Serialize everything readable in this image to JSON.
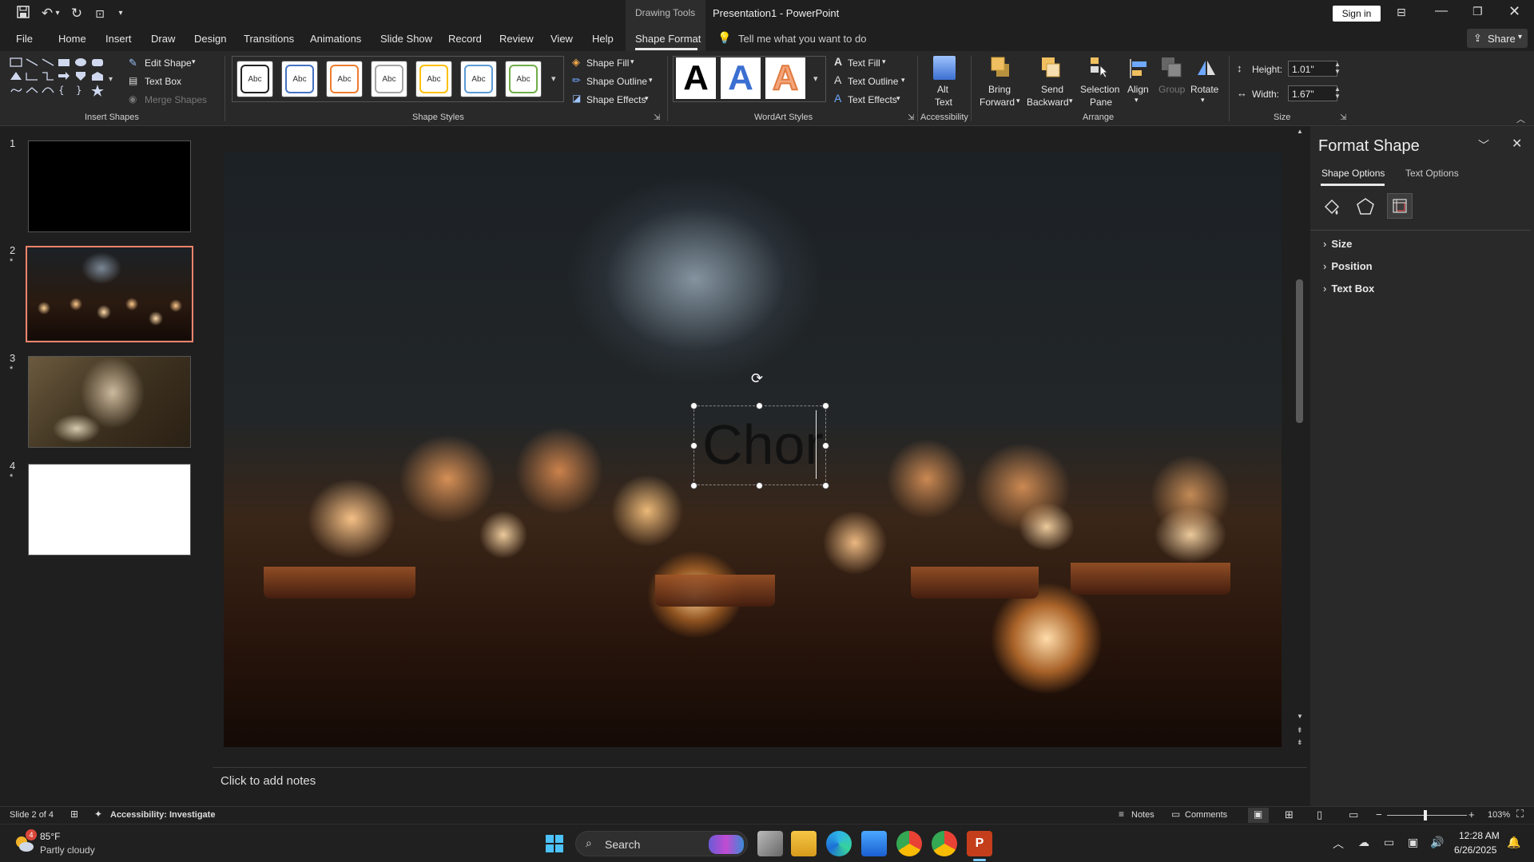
{
  "titlebar": {
    "context_tools": "Drawing Tools",
    "doc_title": "Presentation1 - PowerPoint",
    "sign_in": "Sign in"
  },
  "tabs": [
    "File",
    "Home",
    "Insert",
    "Draw",
    "Design",
    "Transitions",
    "Animations",
    "Slide Show",
    "Record",
    "Review",
    "View",
    "Help",
    "Shape Format"
  ],
  "tell_me": "Tell me what you want to do",
  "share_label": "Share",
  "ribbon": {
    "insert_shapes": {
      "label": "Insert Shapes",
      "edit_shape": "Edit Shape",
      "text_box": "Text Box",
      "merge_shapes": "Merge Shapes"
    },
    "shape_styles": {
      "label": "Shape Styles",
      "swatch_text": "Abc",
      "swatch_colors": [
        "#222222",
        "#4472c4",
        "#ed7d31",
        "#a5a5a5",
        "#ffc000",
        "#5b9bd5",
        "#70ad47"
      ],
      "shape_fill": "Shape Fill",
      "shape_outline": "Shape Outline",
      "shape_effects": "Shape Effects"
    },
    "wordart": {
      "label": "WordArt Styles",
      "letter": "A",
      "text_fill": "Text Fill",
      "text_outline": "Text Outline",
      "text_effects": "Text Effects"
    },
    "accessibility": {
      "label": "Accessibility",
      "alt_text_1": "Alt",
      "alt_text_2": "Text"
    },
    "arrange": {
      "label": "Arrange",
      "bring_forward_1": "Bring",
      "bring_forward_2": "Forward",
      "send_backward_1": "Send",
      "send_backward_2": "Backward",
      "selection_pane_1": "Selection",
      "selection_pane_2": "Pane",
      "align": "Align",
      "group": "Group",
      "rotate": "Rotate"
    },
    "size": {
      "label": "Size",
      "height_label": "Height:",
      "height_value": "1.01\"",
      "width_label": "Width:",
      "width_value": "1.67\""
    }
  },
  "slides": [
    {
      "num": "1",
      "star": ""
    },
    {
      "num": "2",
      "star": "*"
    },
    {
      "num": "3",
      "star": "*"
    },
    {
      "num": "4",
      "star": "*"
    }
  ],
  "slide_text": "Chor",
  "notes_placeholder": "Click to add notes",
  "format_pane": {
    "title": "Format Shape",
    "tab_shape": "Shape Options",
    "tab_text": "Text Options",
    "sections": [
      "Size",
      "Position",
      "Text Box"
    ]
  },
  "status": {
    "slide_of": "Slide 2 of 4",
    "accessibility": "Accessibility: Investigate",
    "notes": "Notes",
    "comments": "Comments",
    "zoom": "103%"
  },
  "taskbar": {
    "temp": "85°F",
    "weather": "Partly cloudy",
    "badge": "4",
    "search": "Search",
    "time": "12:28 AM",
    "date": "6/26/2025"
  }
}
